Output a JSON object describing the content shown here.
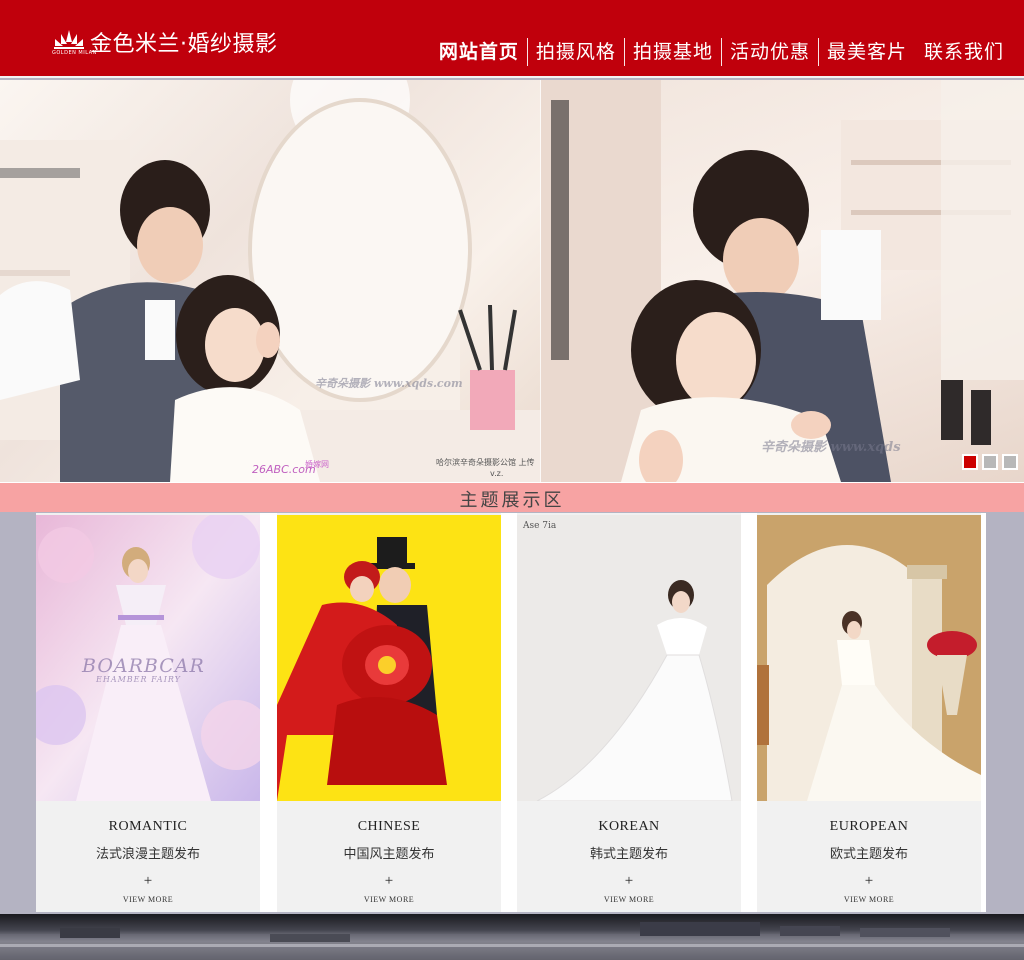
{
  "header": {
    "logo_text": "金色米兰·婚纱摄影",
    "logo_sub": "GOLDEN MILAN",
    "brand_color": "#c0000c"
  },
  "nav": {
    "items": [
      {
        "label": "网站首页",
        "active": true
      },
      {
        "label": "拍摄风格"
      },
      {
        "label": "拍摄基地"
      },
      {
        "label": "活动优惠"
      },
      {
        "label": "最美客片"
      },
      {
        "label": "联系我们"
      }
    ]
  },
  "banner": {
    "watermark_left": "辛奇朵摄影 www.xqds.com",
    "watermark_right": "辛奇朵摄影 www.xqds",
    "site_mark": "26ABC.com",
    "site_mark_label": "婚嫁网",
    "credit": "哈尔滨辛奇朵摄影公馆 上传",
    "credit_sub": "v.z.",
    "active_slide": 1,
    "slide_count": 3,
    "dot_active_color": "#cc0000"
  },
  "section": {
    "title": "主题展示区",
    "bar_color": "#f7a3a3"
  },
  "cards": [
    {
      "title_en": "ROMANTIC",
      "title_cn": "法式浪漫主题发布",
      "plus": "+",
      "more": "VIEW MORE",
      "img_text": "BOARBCAR",
      "img_text2": "EHAMBER FAIRY",
      "icon": "romantic-photo"
    },
    {
      "title_en": "CHINESE",
      "title_cn": "中国风主题发布",
      "plus": "+",
      "more": "VIEW MORE",
      "icon": "chinese-photo"
    },
    {
      "title_en": "KOREAN",
      "title_cn": "韩式主题发布",
      "plus": "+",
      "more": "VIEW MORE",
      "img_text": "Ase 7ia",
      "icon": "korean-photo"
    },
    {
      "title_en": "EUROPEAN",
      "title_cn": "欧式主题发布",
      "plus": "+",
      "more": "VIEW MORE",
      "icon": "european-photo"
    }
  ]
}
